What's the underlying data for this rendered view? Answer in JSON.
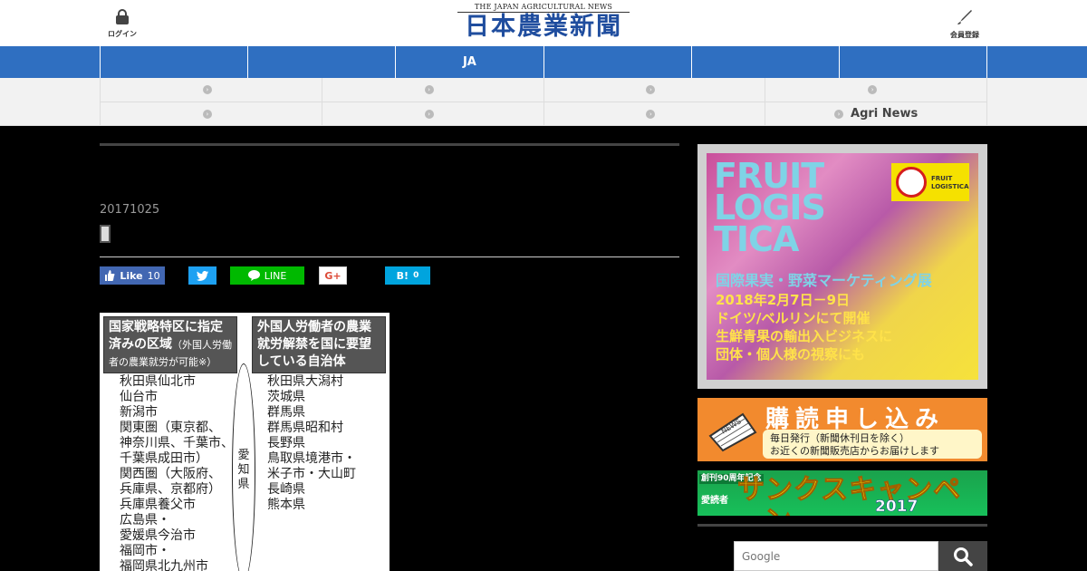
{
  "header": {
    "login_label": "ログイン",
    "register_label": "会員登録",
    "logo_en": "THE JAPAN AGRICULTURAL NEWS",
    "logo_jp": "日本農業新聞"
  },
  "nav": {
    "items": [
      "",
      "",
      "JA",
      "",
      "",
      ""
    ]
  },
  "subnav": {
    "row1": [
      "",
      "",
      "",
      ""
    ],
    "row2": [
      "",
      "",
      "",
      "Agri News"
    ]
  },
  "article": {
    "date": "20171025",
    "share": {
      "like_label": "Like",
      "like_count": "10",
      "line_label": "LINE",
      "gplus_label": "G+",
      "hatena_label": "B!",
      "hatena_count": "0"
    },
    "figure": {
      "left_head": "国家戦略特区に指定済みの区域",
      "left_head_note": "（外国人労働者の農業就労が可能※）",
      "right_head": "外国人労働者の農業就労解禁を国に要望している自治体",
      "left_list": "秋田県仙北市\n仙台市\n新潟市\n関東圏（東京都、\n神奈川県、千葉市、\n千葉県成田市）\n関西圏（大阪府、\n兵庫県、京都府）\n兵庫県養父市\n広島県・\n愛媛県今治市\n福岡市・\n福岡県北九州市",
      "right_list": "秋田県大潟村\n茨城県\n群馬県\n群馬県昭和村\n長野県\n鳥取県境港市・\n米子市・大山町\n長崎県\n熊本県",
      "oval_label": "愛知県"
    }
  },
  "sidebar": {
    "fruit_ad": {
      "title_lines": [
        "FRUIT",
        "LOGIS",
        "TICA"
      ],
      "logo_text": "FRUIT LOGISTICA",
      "line1": "国際果実・野菜マーケティング展",
      "line2": "2018年2月7日－9日",
      "line3": "ドイツ/ベルリンにて開催",
      "line4": "生鮮青果の輸出入ビジネスに",
      "line5": "団体・個人様の視察にも"
    },
    "subscribe_ad": {
      "title": "購読申し込み",
      "icon_label": "NEWS",
      "line1": "毎日発行（新聞休刊日を除く）",
      "line2": "お近くの新聞販売店からお届けします"
    },
    "campaign_ad": {
      "small": "創刊90周年記念",
      "reader": "愛読者",
      "title": "サンクスキャンペーン",
      "year": "2017"
    },
    "search": {
      "placeholder": "Google"
    }
  },
  "colors": {
    "nav_blue": "#2f6fc1",
    "logo_blue": "#1f4d9e",
    "subscribe_orange": "#f28a2e",
    "campaign_green": "#17c05a"
  }
}
